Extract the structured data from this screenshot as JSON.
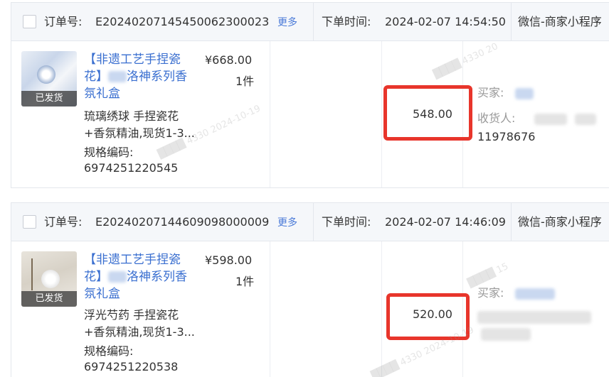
{
  "labels": {
    "order_no": "订单号:",
    "more": "更多",
    "order_time": "下单时间:",
    "channel": "微信-商家小程序",
    "spec_code": "规格编码:",
    "buyer": "买家:",
    "receiver": "收货人:"
  },
  "orders": [
    {
      "order_id": "E20240207145450062300023",
      "time": "2024-02-07 14:54:50",
      "status": "已发货",
      "title": "【非遗工艺手捏瓷花】洛神系列香氛礼盒",
      "title_line1": "【非遗工艺手捏瓷",
      "title_line2": "花】",
      "title_line2b": "洛神系列香",
      "title_line3": "氛礼盒",
      "price": "¥668.00",
      "qty": "1件",
      "spec_line1": "琉璃绣球 手捏瓷花",
      "spec_line2": "+香氛精油,现货1-3...",
      "spec_code": "6974251220545",
      "amount": "548.00",
      "phone": "11978676"
    },
    {
      "order_id": "E20240207144609098000009",
      "time": "2024-02-07 14:46:09",
      "status": "已发货",
      "title": "【非遗工艺手捏瓷花】洛神系列香氛礼盒",
      "title_line1": "【非遗工艺手捏瓷",
      "title_line2": "花】",
      "title_line2b": "洛神系列香",
      "title_line3": "氛礼盒",
      "price": "¥598.00",
      "qty": "1件",
      "spec_line1": "浮光芍药 手捏瓷花",
      "spec_line2": "+香氛精油,现货1-3...",
      "spec_code": "6974251220538",
      "amount": "520.00"
    }
  ],
  "colors": {
    "link": "#3a6fd0",
    "highlight": "#e8352b",
    "header_bg": "#f5f7fa"
  }
}
